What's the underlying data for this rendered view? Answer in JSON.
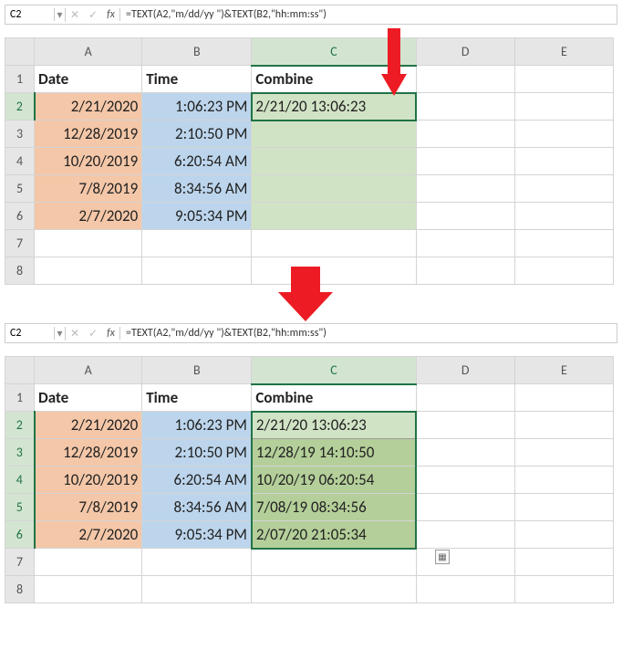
{
  "formula_bar": {
    "cell_ref": "C2",
    "formula": "=TEXT(A2,\"m/dd/yy \")&TEXT(B2,\"hh:mm:ss\")"
  },
  "headers": {
    "date": "Date",
    "time": "Time",
    "combine": "Combine"
  },
  "columns": [
    "A",
    "B",
    "C",
    "D",
    "E"
  ],
  "rows": [
    "1",
    "2",
    "3",
    "4",
    "5",
    "6",
    "7",
    "8"
  ],
  "data_rows": [
    {
      "date": "2/21/2020",
      "time": "1:06:23 PM",
      "combine": "2/21/20 13:06:23"
    },
    {
      "date": "12/28/2019",
      "time": "2:10:50 PM",
      "combine": "12/28/19 14:10:50"
    },
    {
      "date": "10/20/2019",
      "time": "6:20:54 AM",
      "combine": "10/20/19 06:20:54"
    },
    {
      "date": "7/8/2019",
      "time": "8:34:56 AM",
      "combine": "7/08/19 08:34:56"
    },
    {
      "date": "2/7/2020",
      "time": "9:05:34 PM",
      "combine": "2/07/20 21:05:34"
    }
  ],
  "chart_data": {
    "type": "table",
    "title": "Combining Date and Time columns using TEXT formula",
    "columns": [
      "Date",
      "Time",
      "Combine"
    ],
    "rows": [
      [
        "2/21/2020",
        "1:06:23 PM",
        "2/21/20 13:06:23"
      ],
      [
        "12/28/2019",
        "2:10:50 PM",
        "12/28/19 14:10:50"
      ],
      [
        "10/20/2019",
        "6:20:54 AM",
        "10/20/19 06:20:54"
      ],
      [
        "7/8/2019",
        "8:34:56 AM",
        "7/08/19 08:34:56"
      ],
      [
        "2/7/2020",
        "9:05:34 PM",
        "2/07/20 21:05:34"
      ]
    ]
  }
}
